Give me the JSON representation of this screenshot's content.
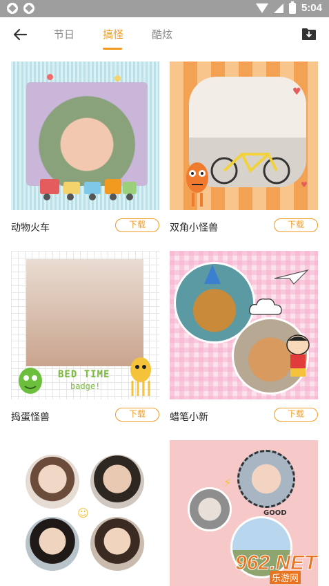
{
  "status_bar": {
    "time": "5:04"
  },
  "nav": {
    "tabs": [
      {
        "label": "节日",
        "active": false
      },
      {
        "label": "搞怪",
        "active": true
      },
      {
        "label": "酷炫",
        "active": false
      }
    ]
  },
  "items": [
    {
      "title": "动物火车",
      "download_label": "下载"
    },
    {
      "title": "双角小怪兽",
      "download_label": "下载"
    },
    {
      "title": "捣蛋怪兽",
      "download_label": "下载"
    },
    {
      "title": "蜡笔小新",
      "download_label": "下载"
    }
  ],
  "overlay_text": {
    "bedtime_line1": "BED TIME",
    "bedtime_line2": "badge!",
    "good": "GOOD"
  },
  "watermark": {
    "number": "962.NET",
    "site": "乐游网"
  },
  "colors": {
    "accent": "#f29a1f",
    "status_bar": "#9e9e9e"
  }
}
